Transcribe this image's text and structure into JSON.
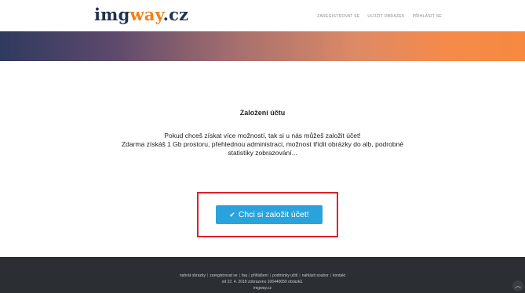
{
  "header": {
    "logo_parts": {
      "a": "img",
      "b": "way",
      "c": ".cz"
    },
    "nav": [
      "ZAREGISTROVAT SE",
      "ULOŽIT OBRÁZEK",
      "PŘIHLÁSIT SE"
    ]
  },
  "main": {
    "title": "Založení účtu",
    "desc_lines": [
      "Pokud chceš získat více možností, tak si u nás můžeš založit účet!",
      "Zdarma získáš 1 Gb prostoru, přehlednou administraci, možnost třídit obrázky do alb, podrobné",
      "statistiky zobrazování..."
    ],
    "cta_label": "Chci si založit účet!"
  },
  "footer": {
    "links": [
      "nahrát obrázky",
      "zaregistrovat se",
      "faq",
      "přihlášení",
      "podmínky užití",
      "nahlásit soubor",
      "kontakt"
    ],
    "line2": "od 22. 4. 2018 zobrazeno 106440050 obrázků.",
    "line3": "imgway.cz"
  },
  "colors": {
    "brand_dark": "#1f3350",
    "brand_orange": "#f0821e",
    "cta_blue": "#2aa3dc",
    "highlight_red": "#e0202a",
    "footer_bg": "#2b2f34"
  },
  "icons": {
    "cta": "check-icon",
    "scroll": "chevron-up-icon"
  }
}
